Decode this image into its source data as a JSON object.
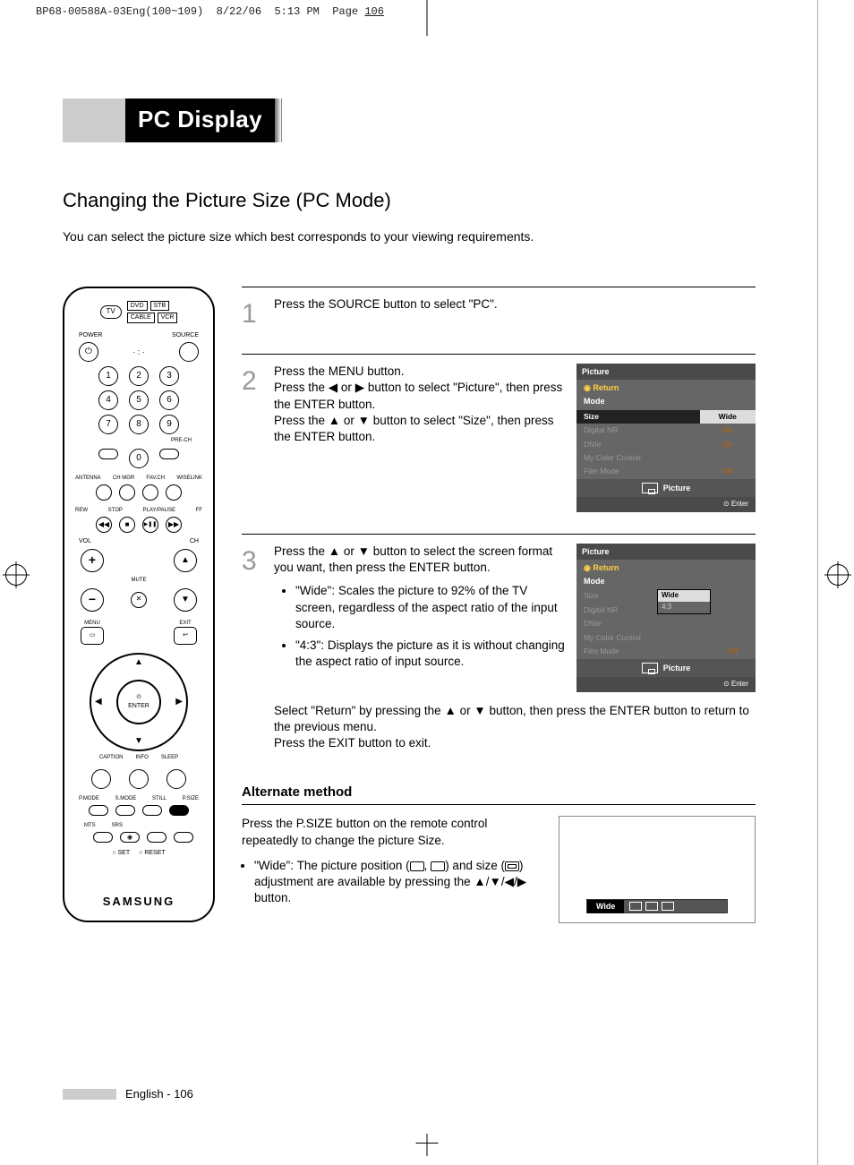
{
  "print_header": {
    "file": "BP68-00588A-03Eng(100~109)",
    "date": "8/22/06",
    "time": "5:13 PM",
    "page_label": "Page",
    "page_num": "106"
  },
  "title": "PC Display",
  "subhead": "Changing the Picture Size (PC Mode)",
  "intro": "You can select the picture size which best corresponds to your viewing requirements.",
  "remote": {
    "tv": "TV",
    "sources": [
      "DVD",
      "STB",
      "CABLE",
      "VCR"
    ],
    "power": "POWER",
    "source": "SOURCE",
    "precn": "PRE-CH",
    "row_labels": [
      "ANTENNA",
      "CH MGR",
      "FAV.CH",
      "WISELINK"
    ],
    "media_labels": [
      "REW",
      "STOP",
      "PLAY/PAUSE",
      "FF"
    ],
    "vol": "VOL",
    "ch": "CH",
    "mute": "MUTE",
    "menu": "MENU",
    "exit": "EXIT",
    "enter": "ENTER",
    "bottom_labels1": [
      "CAPTION",
      "INFO",
      "SLEEP"
    ],
    "bottom_labels2": [
      "P.MODE",
      "S.MODE",
      "STILL",
      "P.SIZE"
    ],
    "bottom_labels3": [
      "MTS",
      "SRS"
    ],
    "set": "SET",
    "reset": "RESET",
    "brand": "SAMSUNG"
  },
  "steps": {
    "s1": {
      "num": "1",
      "text": "Press the SOURCE button to select \"PC\"."
    },
    "s2": {
      "num": "2",
      "t1": "Press the MENU button.",
      "t2a": "Press the ",
      "t2b": " or ",
      "t2c": " button to select \"Picture\", then press the ENTER button.",
      "t3a": "Press the ",
      "t3b": " or ",
      "t3c": " button to select \"Size\", then press the ENTER button."
    },
    "s3": {
      "num": "3",
      "t1a": "Press the ",
      "t1b": " or ",
      "t1c": " button to select the screen format you want, then press the ENTER button.",
      "b1": "\"Wide\": Scales the picture to 92% of the TV screen, regardless of the aspect ratio of the input source.",
      "b2": "\"4:3\": Displays the picture as it is without changing the aspect ratio of input source.",
      "ret1a": "Select \"Return\" by pressing the ",
      "ret1b": " or ",
      "ret1c": " button, then press the ENTER button to return to the previous menu.",
      "ret2": "Press the EXIT button to exit."
    }
  },
  "osd": {
    "title": "Picture",
    "return": "Return",
    "mode": "Mode",
    "rows": [
      {
        "label": "Size",
        "value": "Wide",
        "hi": true
      },
      {
        "label": "Digital NR",
        "value": "On"
      },
      {
        "label": "DNIe",
        "value": "On"
      },
      {
        "label": "My Color Control",
        "value": ""
      },
      {
        "label": "Film Mode",
        "value": "Off"
      }
    ],
    "tab": "Picture",
    "enter": "Enter",
    "dropdown": [
      "Wide",
      "4:3"
    ]
  },
  "alt": {
    "head": "Alternate method",
    "p1": "Press the P.SIZE button on the remote control repeatedly to change the picture Size.",
    "b1a": "\"Wide\": The picture position (",
    "b1b": ", ",
    "b1c": ") and size (",
    "b1d": ") adjustment are available by pressing the ",
    "b1e": " button.",
    "arrows": "▲/▼/◀/▶",
    "wide": "Wide"
  },
  "footer": {
    "lang": "English - 106"
  },
  "glyphs": {
    "left": "◀",
    "right": "▶",
    "up": "▲",
    "down": "▼",
    "power": "⏻",
    "mute": "✕",
    "play": "▶❚❚",
    "rew": "◀◀",
    "ff": "▶▶",
    "stop": "■",
    "dot_e": "⊙",
    "ret": "↩"
  }
}
